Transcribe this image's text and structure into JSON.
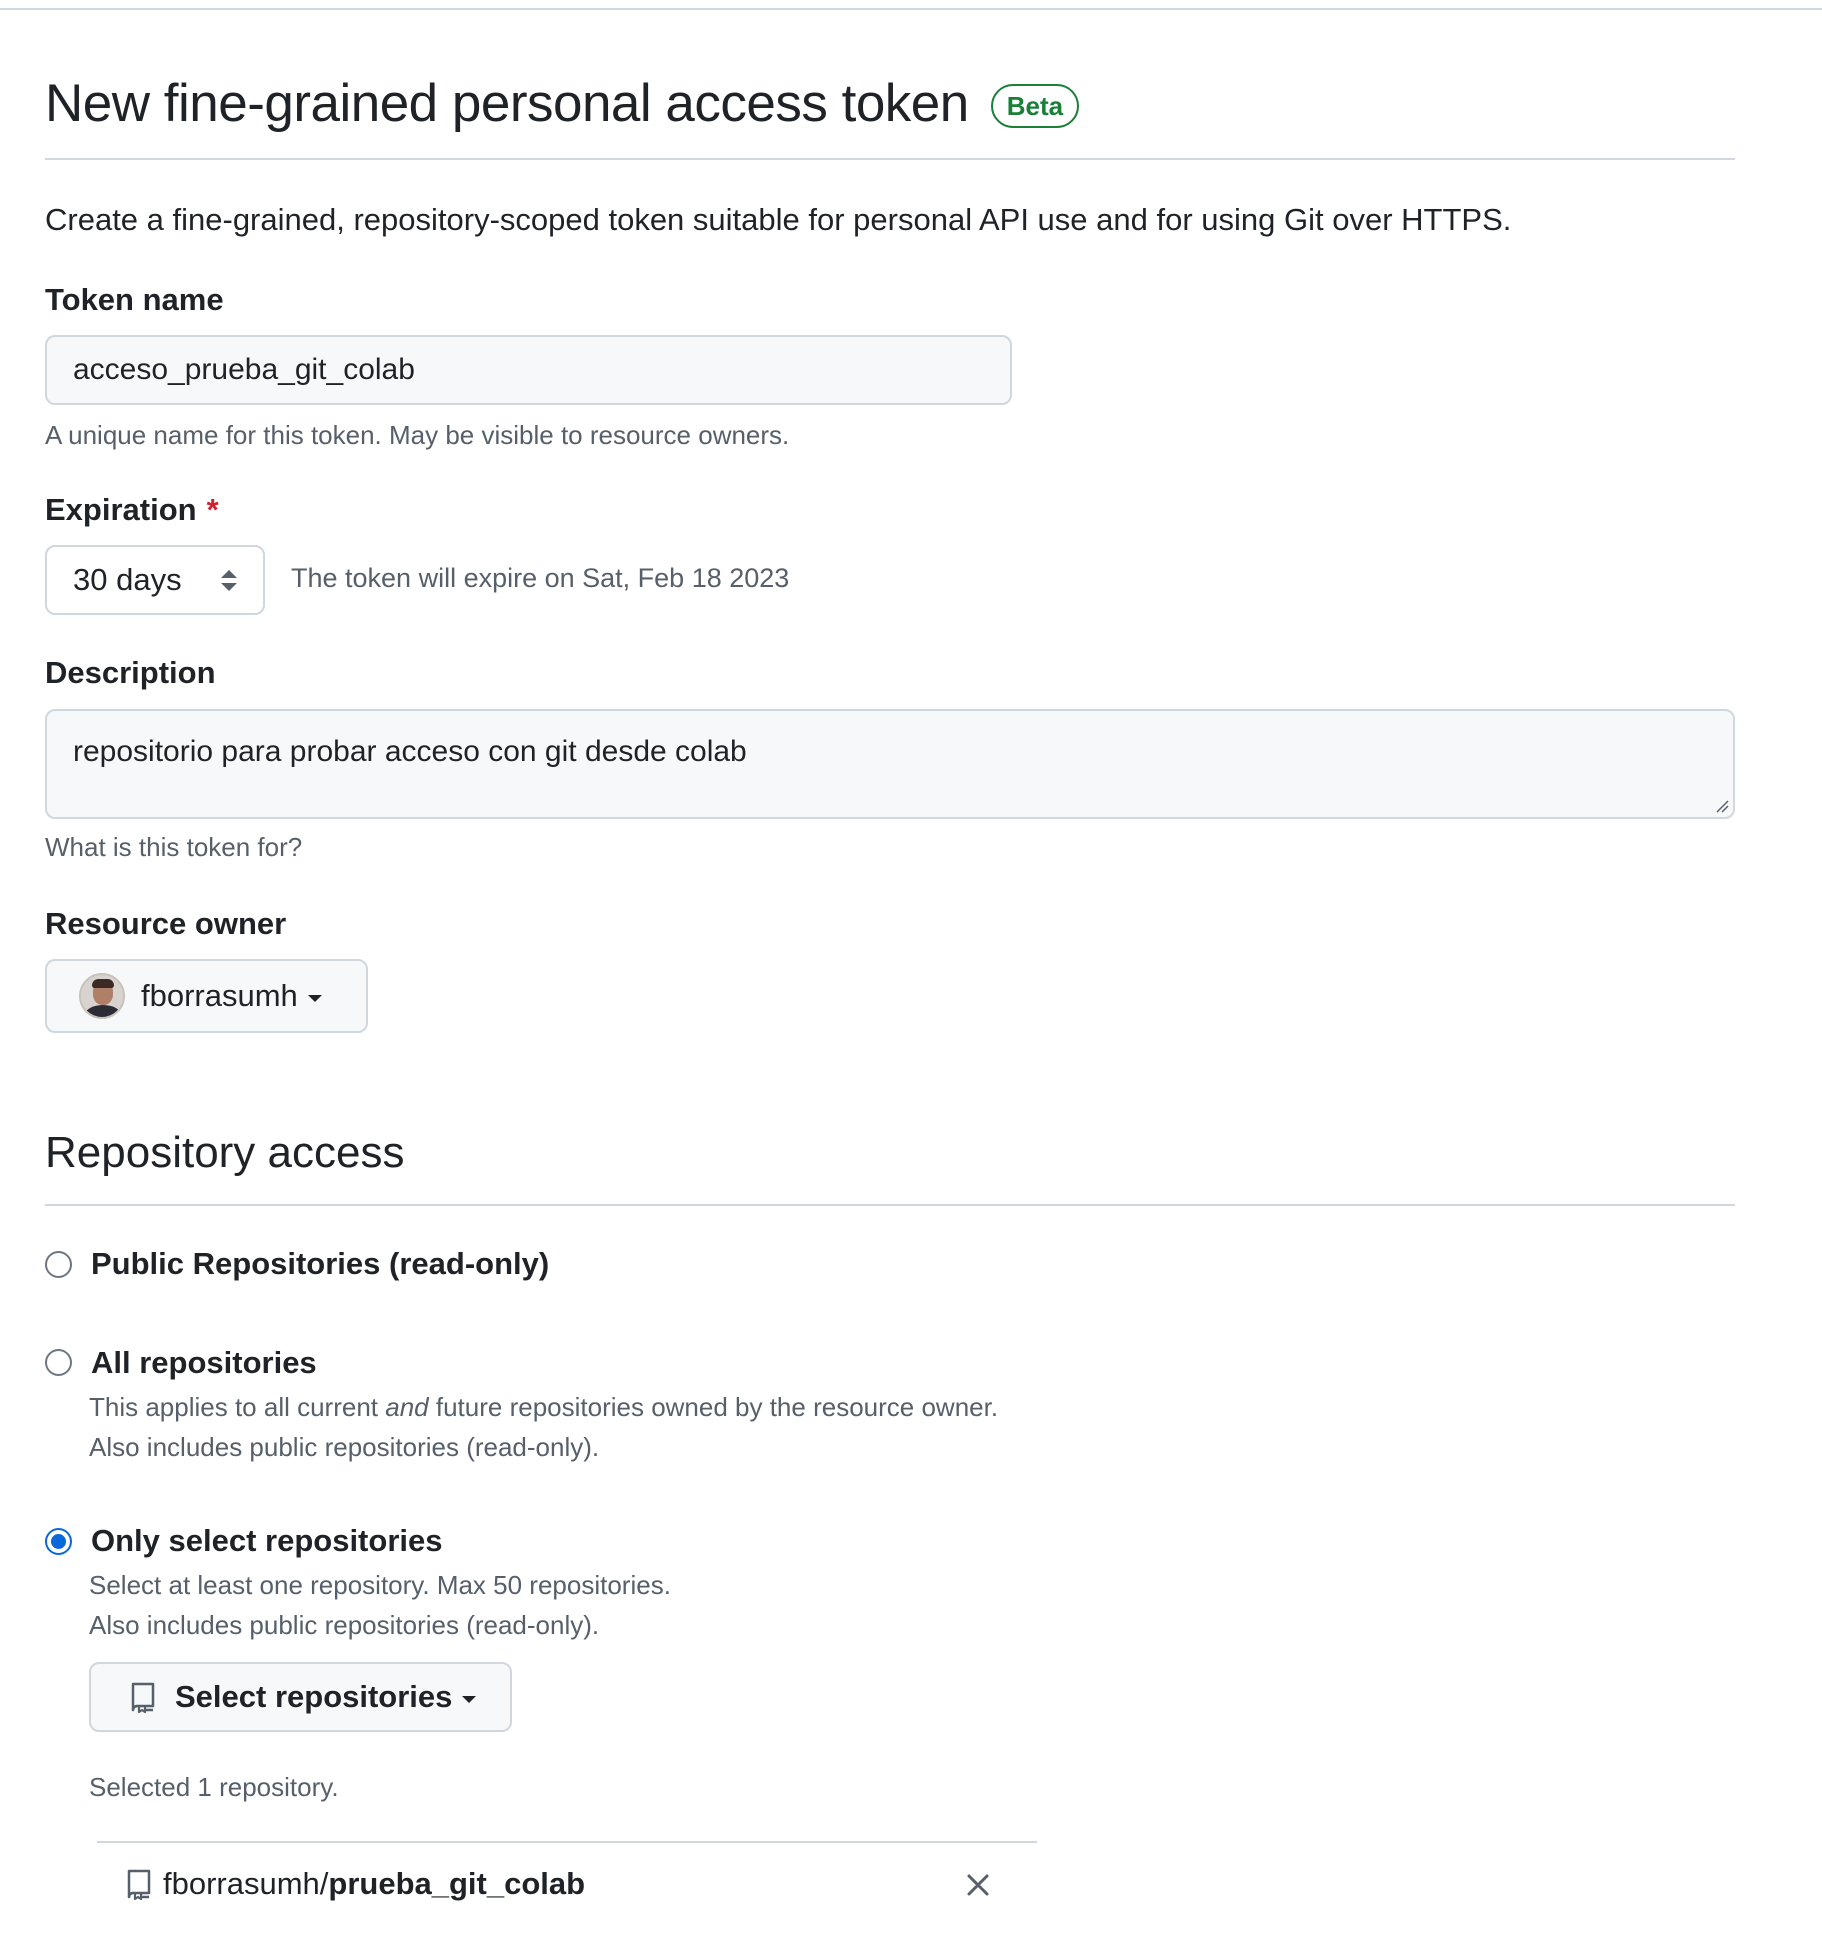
{
  "header": {
    "title": "New fine-grained personal access token",
    "badge": "Beta",
    "intro": "Create a fine-grained, repository-scoped token suitable for personal API use and for using Git over HTTPS."
  },
  "token_name": {
    "label": "Token name",
    "value": "acceso_prueba_git_colab",
    "hint": "A unique name for this token. May be visible to resource owners."
  },
  "expiration": {
    "label": "Expiration",
    "required_mark": "*",
    "selected": "30 days",
    "note": "The token will expire on Sat, Feb 18 2023"
  },
  "description": {
    "label": "Description",
    "value": "repositorio para probar acceso con git desde colab",
    "hint": "What is this token for?"
  },
  "resource_owner": {
    "label": "Resource owner",
    "selected": "fborrasumh"
  },
  "repository_access": {
    "title": "Repository access",
    "options": [
      {
        "label": "Public Repositories (read-only)",
        "checked": false
      },
      {
        "label": "All repositories",
        "note_before": "This applies to all current ",
        "note_em": "and",
        "note_after": " future repositories owned by the resource owner.",
        "note2": "Also includes public repositories (read-only).",
        "checked": false
      },
      {
        "label": "Only select repositories",
        "note": "Select at least one repository. Max 50 repositories.",
        "note2": "Also includes public repositories (read-only).",
        "checked": true
      }
    ],
    "select_button": "Select repositories",
    "selected_count": "Selected 1 repository.",
    "selected_repos": [
      {
        "owner": "fborrasumh/",
        "name": "prueba_git_colab"
      }
    ]
  },
  "icons": {
    "repo": "repo-icon",
    "remove": "x-icon",
    "expiration_toggle": "up-down-caret-icon",
    "dropdown": "caret-down-icon"
  },
  "colors": {
    "badge_green": "#1a7f37",
    "required_red": "#cf222e",
    "radio_blue": "#0969da",
    "muted_text": "#57606a",
    "border": "#d0d7de"
  }
}
